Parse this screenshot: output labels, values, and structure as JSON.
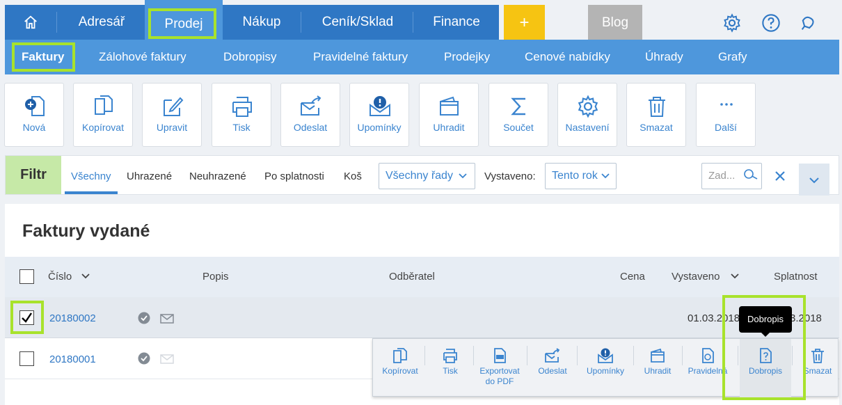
{
  "topnav": {
    "items": [
      "Adresář",
      "Prodej",
      "Nákup",
      "Ceník/Sklad",
      "Finance"
    ],
    "plus": "+",
    "blog": "Blog"
  },
  "subnav": {
    "items": [
      "Faktury",
      "Zálohové faktury",
      "Dobropisy",
      "Pravidelné faktury",
      "Prodejky",
      "Cenové nabídky",
      "Úhrady",
      "Grafy"
    ]
  },
  "toolbar": {
    "items": [
      "Nová",
      "Kopírovat",
      "Upravit",
      "Tisk",
      "Odeslat",
      "Upomínky",
      "Uhradit",
      "Součet",
      "Nastavení",
      "Smazat",
      "Další"
    ]
  },
  "filter": {
    "label": "Filtr",
    "tabs": [
      "Všechny",
      "Uhrazené",
      "Neuhrazené",
      "Po splatnosti",
      "Koš"
    ],
    "series_select": "Všechny řady",
    "issued_label": "Vystaveno:",
    "issued_select": "Tento rok",
    "search_placeholder": "Zad..."
  },
  "main": {
    "title": "Faktury vydané",
    "columns": [
      "Číslo",
      "Popis",
      "Odběratel",
      "Cena",
      "Vystaveno",
      "Splatnost"
    ],
    "rows": [
      {
        "number": "20180002",
        "issued": "01.03.2018",
        "due": "3.2018",
        "checked": true
      },
      {
        "number": "20180001",
        "checked": false
      }
    ]
  },
  "row_actions": {
    "items": [
      "Kopírovat",
      "Tisk",
      "Exportovat do PDF",
      "Odeslat",
      "Upomínky",
      "Uhradit",
      "Pravidelná",
      "Dobropis",
      "Smazat"
    ],
    "tooltip": "Dobropis"
  },
  "colors": {
    "nav": "#2f77c4",
    "subnav": "#4e97dc",
    "highlight": "#a8e22c",
    "accent": "#3a84cf",
    "plus": "#f6c412",
    "blog": "#b4b4b4"
  }
}
